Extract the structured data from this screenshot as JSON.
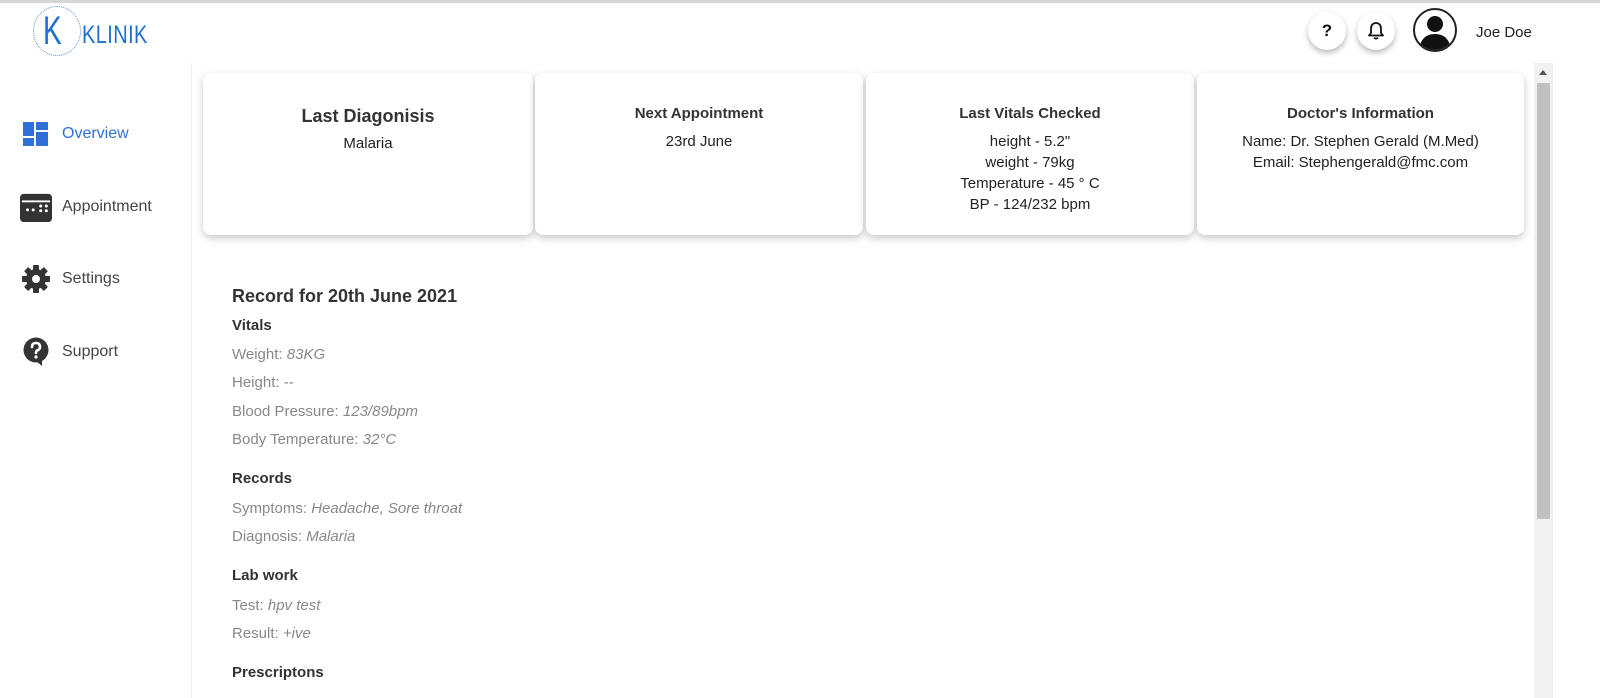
{
  "app": {
    "logo_letter": "K",
    "logo_text": "KLINIK",
    "brand_color": "#1f6fd1"
  },
  "header": {
    "help_label": "?",
    "help_icon": "question-mark-icon",
    "notifications_icon": "bell-icon",
    "avatar_icon": "user-avatar-icon",
    "username": "Joe Doe"
  },
  "sidebar": {
    "items": [
      {
        "label": "Overview",
        "icon": "dashboard-icon",
        "active": true
      },
      {
        "label": "Appointment",
        "icon": "calendar-icon",
        "active": false
      },
      {
        "label": "Settings",
        "icon": "gear-icon",
        "active": false
      },
      {
        "label": "Support",
        "icon": "help-circle-icon",
        "active": false
      }
    ],
    "active_color": "#2f6fd8"
  },
  "cards": [
    {
      "title": "Last Diagonisis",
      "lines": [
        "Malaria"
      ]
    },
    {
      "title": "Next Appointment",
      "lines": [
        "23rd June"
      ]
    },
    {
      "title": "Last Vitals Checked",
      "lines": [
        "height - 5.2\"",
        "weight - 79kg",
        "Temperature - 45 ° C",
        "BP - 124/232 bpm"
      ]
    },
    {
      "title": "Doctor's Information",
      "lines": [
        "Name: Dr. Stephen Gerald (M.Med)",
        "Email: Stephengerald@fmc.com"
      ]
    }
  ],
  "record": {
    "title": "Record for 20th June 2021",
    "vitals": {
      "heading": "Vitals",
      "weight_label": "Weight:",
      "weight_value": "83KG",
      "height_label": "Height: --",
      "bp_label": "Blood Pressure:",
      "bp_value": "123/89bpm",
      "temp_label": "Body Temperature:",
      "temp_value": "32°C"
    },
    "records": {
      "heading": "Records",
      "symptoms_label": "Symptoms:",
      "symptoms_value": "Headache, Sore throat",
      "diagnosis_label": "Diagnosis:",
      "diagnosis_value": "Malaria"
    },
    "lab": {
      "heading": "Lab work",
      "test_label": "Test:",
      "test_value": "hpv test",
      "result_label": "Result:",
      "result_value": "+ive"
    },
    "prescriptions": {
      "heading": "Prescriptons"
    }
  }
}
